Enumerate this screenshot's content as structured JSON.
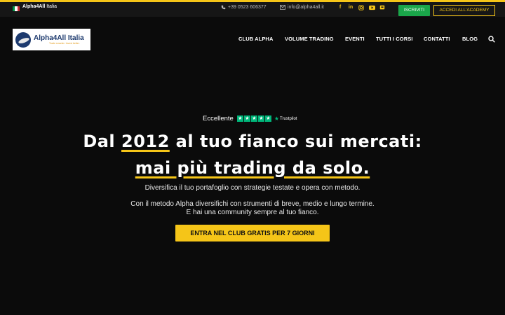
{
  "topbar": {
    "site_name_bold": "Alpha4All",
    "site_name_rest": "Italia",
    "phone": "+39 0523 606377",
    "email": "info@alpha4all.it",
    "socials": [
      "facebook-icon",
      "linkedin-icon",
      "instagram-icon",
      "youtube-icon",
      "discord-icon"
    ],
    "iscriviti_label": "ISCRIVITI",
    "academy_label": "ACCEDI ALL'ACADEMY"
  },
  "logo": {
    "title": "Alpha4All Italia",
    "tagline": "Trade smarter. Invest better."
  },
  "nav": {
    "items": [
      "CLUB ALPHA",
      "VOLUME TRADING",
      "EVENTI",
      "TUTTI I CORSI",
      "CONTATTI",
      "BLOG"
    ]
  },
  "hero": {
    "trust_label": "Eccellente",
    "trust_brand": "Trustpilot",
    "title_line1_a": "Dal ",
    "title_line1_hl": "2012",
    "title_line1_b": " al tuo fianco sui mercati:",
    "title_line2_hl": "mai più trading da solo.",
    "subtitle": "Diversifica il tuo portafoglio con strategie testate e opera con metodo.",
    "body_line1": "Con il metodo Alpha diversifichi con strumenti di breve, medio e lungo termine.",
    "body_line2": "E hai una community sempre al tuo fianco.",
    "cta_label": "ENTRA NEL CLUB GRATIS PER 7 GIORNI"
  },
  "colors": {
    "accent": "#f5c518",
    "green": "#1aa64a",
    "trustpilot": "#00b67a",
    "background": "#0b0b0b"
  }
}
